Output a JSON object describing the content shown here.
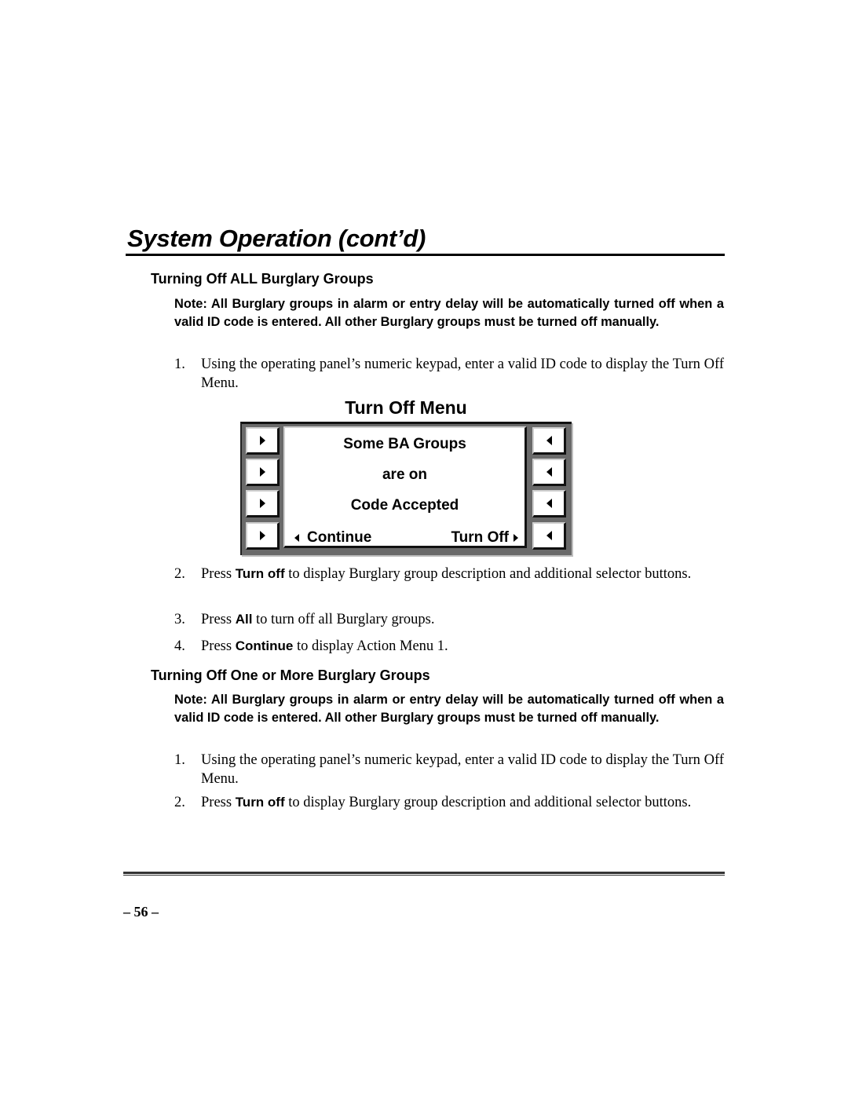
{
  "page": {
    "title": "System Operation (cont’d)",
    "page_number": "– 56 –"
  },
  "section1": {
    "heading": "Turning Off ALL Burglary Groups",
    "note": "Note: All Burglary groups in alarm or entry delay will be automatically turned off when a valid ID code is entered. All other Burglary groups must be turned off manually.",
    "steps": [
      {
        "num": "1.",
        "pre": "Using the operating panel’s numeric keypad, enter a valid ID code to display the Turn Off Menu.",
        "kw": "",
        "post": ""
      },
      {
        "num": "2.",
        "pre": "Press ",
        "kw": "Turn off",
        "post": " to display Burglary group description and additional selector buttons."
      },
      {
        "num": "3.",
        "pre": "Press ",
        "kw": "All",
        "post": " to turn off all Burglary groups."
      },
      {
        "num": "4.",
        "pre": "Press ",
        "kw": "Continue",
        "post": " to display Action Menu 1."
      }
    ]
  },
  "menu": {
    "title": "Turn Off Menu",
    "screen_lines": [
      "Some BA Groups",
      "are on",
      "Code Accepted"
    ],
    "softkeys": {
      "left": "Continue",
      "right": "Turn Off"
    },
    "left_buttons": [
      "right-arrow",
      "right-arrow",
      "right-arrow",
      "right-arrow"
    ],
    "right_buttons": [
      "left-arrow",
      "left-arrow",
      "left-arrow",
      "left-arrow"
    ]
  },
  "section2": {
    "heading": "Turning Off One or More Burglary Groups",
    "note": "Note: All Burglary groups in alarm or entry delay will be automatically turned off when a valid ID code is entered. All other Burglary groups must be turned off manually.",
    "steps": [
      {
        "num": "1.",
        "pre": "Using the operating panel’s numeric keypad, enter a valid ID code to display the Turn Off Menu.",
        "kw": "",
        "post": ""
      },
      {
        "num": "2.",
        "pre": "Press ",
        "kw": "Turn off",
        "post": " to display Burglary group description and additional selector buttons."
      }
    ]
  }
}
